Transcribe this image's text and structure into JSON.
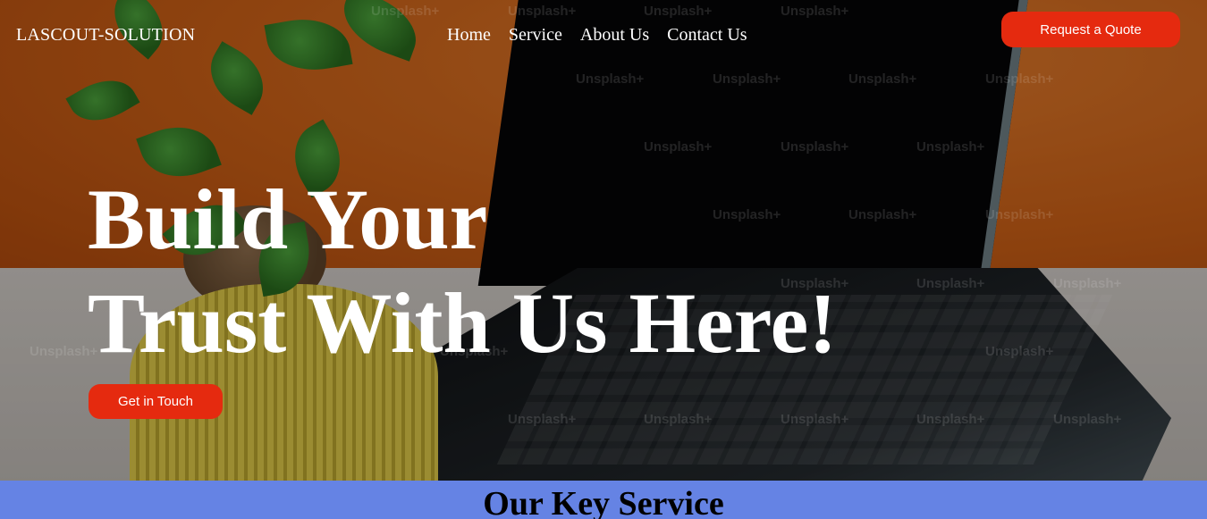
{
  "header": {
    "brand": "LASCOUT-SOLUTION",
    "nav": [
      {
        "label": "Home"
      },
      {
        "label": "Service"
      },
      {
        "label": "About Us"
      },
      {
        "label": "Contact Us"
      }
    ],
    "quote_button": "Request a Quote"
  },
  "hero": {
    "headline_line1": "Build Your",
    "headline_line2": "Trust With Us Here!",
    "cta_button": "Get in Touch",
    "watermark_text": "Unsplash+"
  },
  "services": {
    "title": "Our Key Service"
  },
  "colors": {
    "accent_button": "#e52a0f",
    "services_band": "#6583e4",
    "text_light": "#ffffff"
  }
}
